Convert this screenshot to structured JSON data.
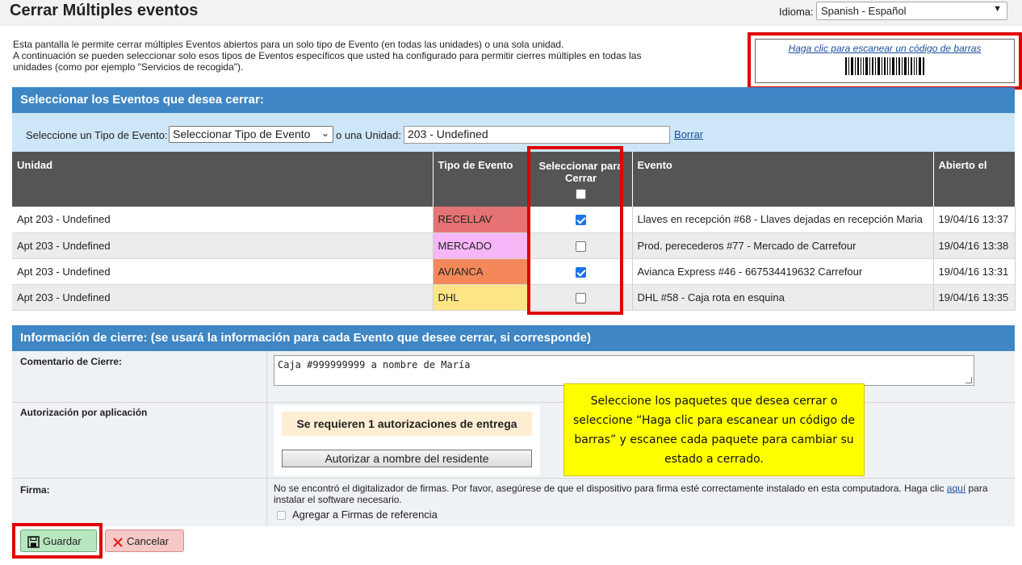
{
  "header": {
    "title": "Cerrar Múltiples eventos",
    "language_label": "Idioma:",
    "language_value": "Spanish - Español"
  },
  "intro": {
    "line1": "Esta pantalla le permite cerrar múltiples Eventos abiertos para un solo tipo de Evento (en todas las unidades) o una sola unidad.",
    "line2": "A continuación se pueden seleccionar solo esos tipos de Eventos específicos que usted ha configurado para permitir cierres múltiples en todas las unidades (como por ejemplo \"Servicios de recogida\")."
  },
  "scan": {
    "link_text": "Haga clic para escanear un código de barras",
    "icon": "barcode-icon"
  },
  "select_section": {
    "title": "Seleccionar los Eventos que desea cerrar:",
    "event_type_label": "Seleccione un Tipo de Evento:",
    "event_type_value": "Seleccionar Tipo de Evento",
    "unit_label": "o una Unidad:",
    "unit_value": "203 - Undefined",
    "clear_link": "Borrar"
  },
  "table": {
    "headers": {
      "unit": "Unidad",
      "type": "Tipo de Evento",
      "select": "Seleccionar para Cerrar",
      "event": "Evento",
      "opened": "Abierto el"
    },
    "rows": [
      {
        "unit": "Apt 203 - Undefined",
        "type": "RECELLAV",
        "type_color": "#e57373",
        "checked": true,
        "event": "Llaves en recepción #68 - Llaves dejadas en recepción Maria",
        "opened": "19/04/16 13:37"
      },
      {
        "unit": "Apt 203 - Undefined",
        "type": "MERCADO",
        "type_color": "#f7b6f7",
        "checked": false,
        "event": "Prod. perecederos #77 - Mercado de Carrefour",
        "opened": "19/04/16 13:38"
      },
      {
        "unit": "Apt 203 - Undefined",
        "type": "AVIANCA",
        "type_color": "#f5885a",
        "checked": true,
        "event": "Avianca Express #46 - 667534419632 Carrefour",
        "opened": "19/04/16 13:31"
      },
      {
        "unit": "Apt 203 - Undefined",
        "type": "DHL",
        "type_color": "#fde585",
        "checked": false,
        "event": "DHL #58 - Caja rota en esquina",
        "opened": "19/04/16 13:35"
      }
    ]
  },
  "close_section": {
    "title": "Información de cierre: (se usará la información para cada Evento que desee cerrar, si corresponde)",
    "comment_label": "Comentario de Cierre:",
    "comment_value": "Caja #999999999 a nombre de María",
    "auth_label": "Autorización por aplicación",
    "auth_notice": "Se requieren 1 autorizaciones de entrega",
    "auth_button": "Autorizar a nombre del residente",
    "signature_label": "Firma:",
    "signature_text_a": "No se encontró el digitalizador de firmas. Por favor, asegúrese de que el dispositivo para firma esté correctamente instalado en esta computadora. Haga clic",
    "signature_link": "aquí",
    "signature_text_b": "para instalar el software necesario.",
    "signature_ref": "Agregar a Firmas de referencia"
  },
  "callout": {
    "text": "Seleccione los paquetes que desea cerrar o seleccione “Haga clic para escanear un código de barras” y escanee cada paquete para cambiar su estado a cerrado."
  },
  "actions": {
    "save": "Guardar",
    "cancel": "Cancelar"
  },
  "colors": {
    "header_blue": "#3f86c4",
    "filter_blue": "#cde6f8",
    "table_header": "#555555",
    "highlight_red": "#e00000",
    "callout_yellow": "#ffff00"
  }
}
